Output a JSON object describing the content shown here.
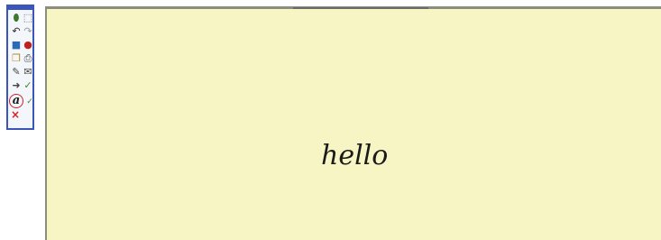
{
  "toolbar": {
    "tools": [
      {
        "icon": "eraser-icon",
        "glyph": "⬮",
        "color": "#3a7a2a"
      },
      {
        "icon": "select-rectangle-icon",
        "glyph": "⬚",
        "color": "#666666"
      },
      {
        "icon": "undo-icon",
        "glyph": "↶",
        "color": "#2a2a2a"
      },
      {
        "icon": "redo-icon",
        "glyph": "↷",
        "color": "#9a9a9a"
      },
      {
        "icon": "page-background-icon",
        "glyph": "■",
        "color": "#2a6bb8"
      },
      {
        "icon": "color-picker-icon",
        "glyph": "●",
        "color": "#c02020"
      },
      {
        "icon": "copy-icon",
        "glyph": "❐",
        "color": "#b58a1a"
      },
      {
        "icon": "print-icon",
        "glyph": "⎙",
        "color": "#444444"
      },
      {
        "icon": "tools-icon",
        "glyph": "✎",
        "color": "#444444"
      },
      {
        "icon": "email-icon",
        "glyph": "✉",
        "color": "#444444"
      },
      {
        "icon": "export-icon",
        "glyph": "➜",
        "color": "#444444"
      },
      {
        "icon": "recognize-icon",
        "glyph": "✓",
        "color": "#3a8a2a"
      }
    ],
    "text_mode_glyph": "a",
    "text_mode_color": "#1a1a1a",
    "circle_color": "#d42020",
    "close_glyph": "×",
    "close_color": "#d42020",
    "accent": "#3b56b8"
  },
  "canvas": {
    "background": "#f7f5c4",
    "ink": "hello"
  }
}
